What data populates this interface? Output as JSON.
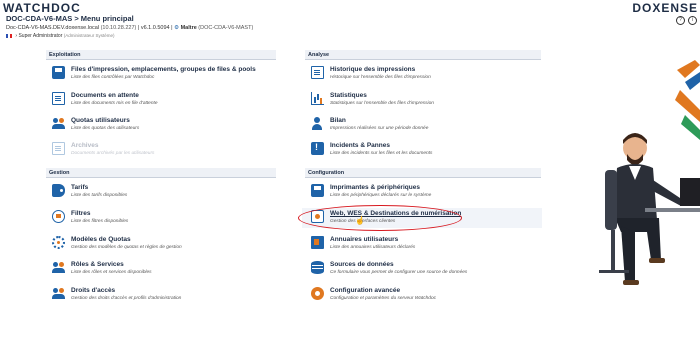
{
  "brand": {
    "left": "WATCHDOC",
    "right": "DOXENSE"
  },
  "header": {
    "title": "DOC-CDA-V6-MAS > Menu principal",
    "host": "Doc-CDA-V6-MAS.DEV.doxense.local",
    "ip": "(10.10.28.227)",
    "version": "v6.1.0.5094",
    "role": "Maître",
    "role_host": "(DOC-CDA-V6-MAST)",
    "user": "Super Administrator",
    "user_role": "(Administrateur Système)"
  },
  "sections": {
    "exploitation": "Exploitation",
    "analyse": "Analyse",
    "gestion": "Gestion",
    "configuration": "Configuration"
  },
  "items": {
    "files": {
      "title": "Files d'impression, emplacements, groupes de files & pools",
      "desc": "Liste des files contrôlées par Watchdoc"
    },
    "docs": {
      "title": "Documents en attente",
      "desc": "Liste des documents mis en file d'attente"
    },
    "quotas": {
      "title": "Quotas utilisateurs",
      "desc": "Liste des quotas des utilisateurs"
    },
    "archives": {
      "title": "Archives",
      "desc": "Documents archivés par les utilisateurs"
    },
    "historique": {
      "title": "Historique des impressions",
      "desc": "Historique sur l'ensemble des files d'impression"
    },
    "stats": {
      "title": "Statistiques",
      "desc": "Statistiques sur l'ensemble des files d'impression"
    },
    "bilan": {
      "title": "Bilan",
      "desc": "Impressions réalisées sur une période donnée"
    },
    "incidents": {
      "title": "Incidents & Pannes",
      "desc": "Liste des incidents sur les files et les documents"
    },
    "tarifs": {
      "title": "Tarifs",
      "desc": "Liste des tarifs disponibles"
    },
    "filtres": {
      "title": "Filtres",
      "desc": "Liste des filtres disponibles"
    },
    "modeles": {
      "title": "Modèles de Quotas",
      "desc": "Gestion des modèles de quotas et règles de gestion"
    },
    "roles": {
      "title": "Rôles & Services",
      "desc": "Liste des rôles et services disponibles"
    },
    "droits": {
      "title": "Droits d'accès",
      "desc": "Gestion des droits d'accès et profils d'administration"
    },
    "imprimantes": {
      "title": "Imprimantes & périphériques",
      "desc": "Liste des périphériques déclarés sur le système"
    },
    "web": {
      "title": "Web, WES & Destinations de numérisation",
      "desc": "Gestion des interfaces clientes"
    },
    "annuaires": {
      "title": "Annuaires utilisateurs",
      "desc": "Liste des annuaires utilisateurs déclarés"
    },
    "sources": {
      "title": "Sources de données",
      "desc": "Ce formulaire vous permet de configurer une source de données"
    },
    "config": {
      "title": "Configuration avancée",
      "desc": "Configuration et paramètres du serveur Watchdoc"
    }
  },
  "colors": {
    "navy": "#1e2d45",
    "blue": "#1f63a8",
    "orange": "#e07820",
    "highlight_red": "#d71920"
  }
}
